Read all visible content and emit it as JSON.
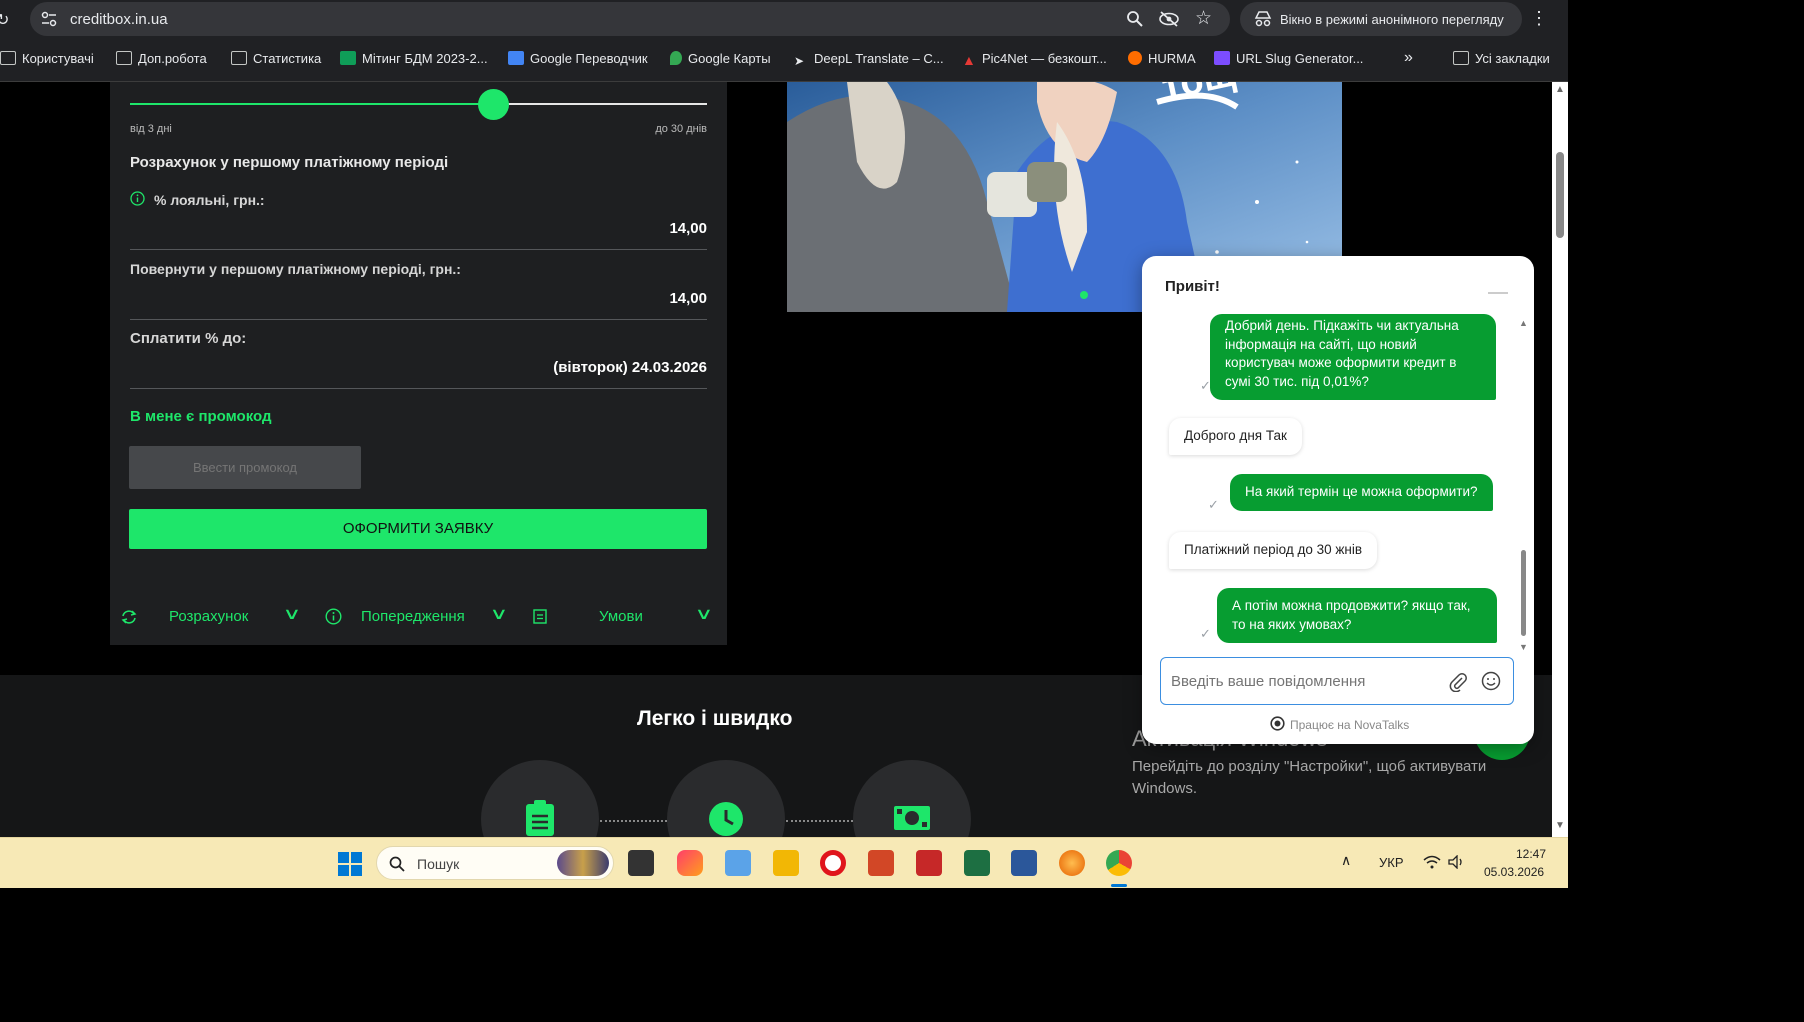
{
  "browser": {
    "url": "creditbox.in.ua",
    "incognito_label": "Вікно в режимі анонімного перегляду",
    "bookmarks": [
      "Користувачі",
      "Доп.робота",
      "Статистика",
      "Мітинг БДМ 2023-2...",
      "Google Переводчик",
      "Google Карты",
      "DeepL Translate – C...",
      "Pic4Net — безкошт...",
      "HURMA",
      "URL Slug Generator..."
    ],
    "all_bookmarks": "Усі закладки",
    "more": "»"
  },
  "calc": {
    "slider_min": "від 3 дні",
    "slider_max": "до 30 днів",
    "slider_fraction": 0.63,
    "section_title": "Розрахунок у першому платіжному періоді",
    "loyal_label": "% лояльні, грн.:",
    "loyal_value": "14,00",
    "return_label": "Повернути у першому платіжному періоді, грн.:",
    "return_value": "14,00",
    "pay_until_label": "Сплатити % до:",
    "pay_until_value": "(вівторок) 24.03.2026",
    "promo_link": "В мене є промокод",
    "promo_placeholder": "Ввести промокод",
    "submit": "ОФОРМИТИ ЗАЯВКУ",
    "tabs": [
      "Розрахунок",
      "Попередження",
      "Умови"
    ]
  },
  "lower": {
    "title": "Легко і швидко"
  },
  "chat": {
    "title": "Привіт!",
    "messages": [
      {
        "from": "user",
        "text": "Добрий день. Підкажіть чи актуальна інформація на сайті, що новий користувач може оформити кредит в сумі 30 тис. під 0,01%?"
      },
      {
        "from": "agent",
        "text": "Доброго дня Так"
      },
      {
        "from": "user",
        "text": "На який термін це можна оформити?"
      },
      {
        "from": "agent",
        "text": "Платіжний період до 30 жнів"
      },
      {
        "from": "user",
        "text": "А потім можна продовжити? якщо так, то на яких умовах?"
      }
    ],
    "input_placeholder": "Введіть ваше повідомлення",
    "powered_by": "Працює на NovaTalks"
  },
  "windows_activation": {
    "title": "Активація Windows",
    "text": "Перейдіть до розділу \"Настройки\", щоб активувати Windows."
  },
  "taskbar": {
    "search_placeholder": "Пошук",
    "language": "УКР",
    "time": "12:47",
    "date": "05.03.2026"
  },
  "colors": {
    "accent": "#1ee66a",
    "chat_bubble": "#079d31",
    "panel": "#1e1f21"
  }
}
